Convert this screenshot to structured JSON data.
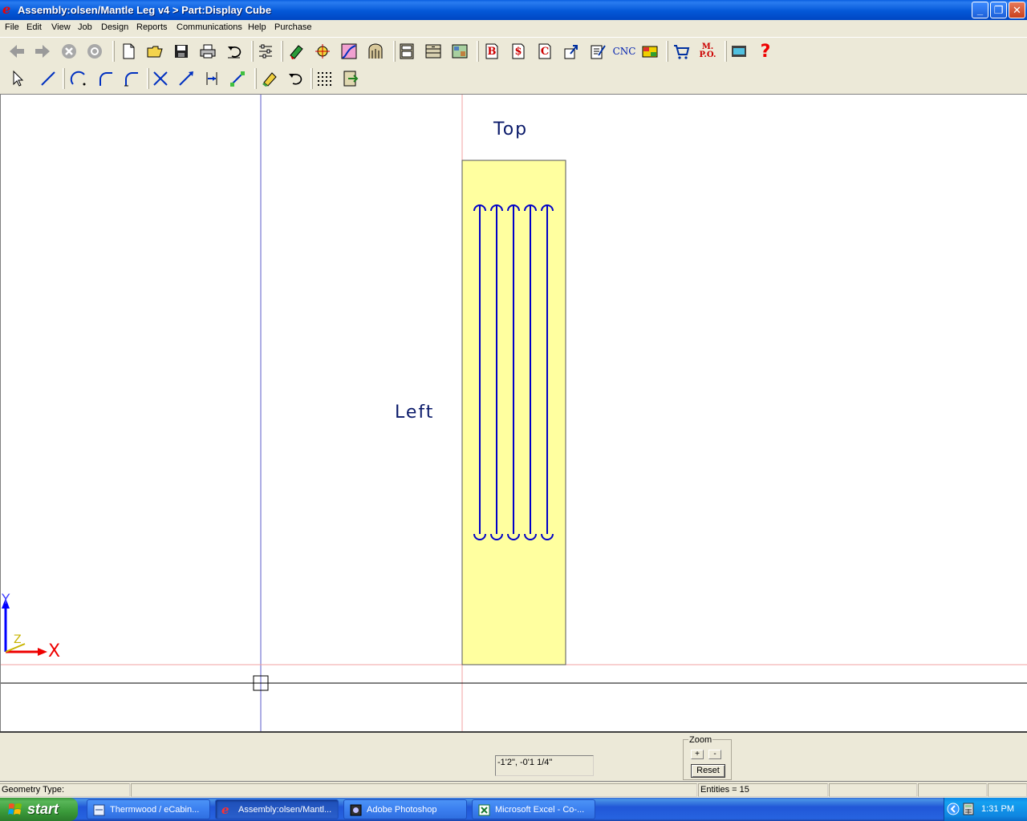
{
  "window": {
    "title": "Assembly:olsen/Mantle Leg v4 > Part:Display Cube",
    "minimize": "_",
    "restore": "❐",
    "close": "✕"
  },
  "menu": [
    "File",
    "Edit",
    "View",
    "Job",
    "Design",
    "Reports",
    "Communications",
    "Help",
    "Purchase"
  ],
  "toolbar_icons": {
    "cnc_label": "CNC",
    "mpo_label_top": "M.",
    "mpo_label_bottom": "P.O.",
    "b_label": "B",
    "s_label": "$",
    "c_label": "C",
    "help_label": "?"
  },
  "canvas": {
    "top_label": "Top",
    "left_label": "Left",
    "axis_x": "X",
    "axis_y": "Y",
    "axis_z": "Z",
    "part_fill": "#ffff9f",
    "line_color": "#0000c8"
  },
  "bottom": {
    "coordinates": "-1'2\", -0'1 1/4\"",
    "zoom_legend": "Zoom",
    "zoom_in": "+",
    "zoom_out": "-",
    "reset": "Reset"
  },
  "status": {
    "geometry_type": "Geometry Type:",
    "entities": "Entities = 15"
  },
  "taskbar": {
    "start": "start",
    "tasks": [
      {
        "label": "Thermwood / eCabin..."
      },
      {
        "label": "Assembly:olsen/Mantl..."
      },
      {
        "label": "Adobe Photoshop"
      },
      {
        "label": "Microsoft Excel - Co-..."
      }
    ],
    "clock": "1:31 PM"
  }
}
